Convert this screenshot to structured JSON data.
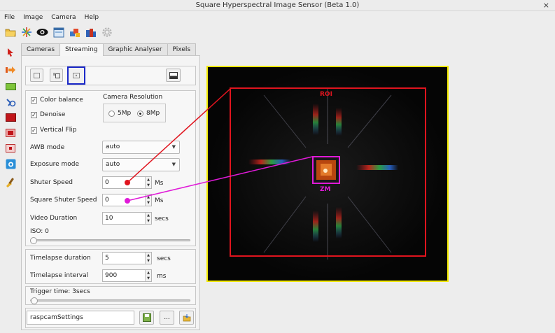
{
  "window": {
    "title": "Square Hyperspectral Image Sensor (Beta 1.0)",
    "close_glyph": "×"
  },
  "menu": [
    "File",
    "Image",
    "Camera",
    "Help"
  ],
  "toolbar": [
    "open-folder-icon",
    "burst-icon",
    "eye-icon",
    "window-icon",
    "cubes-icon",
    "cubes-color-icon",
    "gear-icon"
  ],
  "sidebar": [
    "pointer-icon",
    "arrow-right-icon",
    "green-rect-icon",
    "tools-icon",
    "red-rect-icon",
    "red-rect-2-icon",
    "red-rect-3-icon",
    "camera-icon",
    "brush-icon"
  ],
  "tabs": [
    "Cameras",
    "Streaming",
    "Graphic Analyser",
    "Pixels"
  ],
  "active_tab": "Streaming",
  "settings": {
    "color_balance": "Color balance",
    "denoise": "Denoise",
    "vertical_flip": "Vertical Flip",
    "check_glyph": "✓",
    "camera_resolution": "Camera Resolution",
    "res_5": "5Mp",
    "res_8": "8Mp",
    "selected_resolution": "8Mp",
    "awb_label": "AWB mode",
    "awb_value": "auto",
    "exposure_label": "Exposure mode",
    "exposure_value": "auto",
    "shutter_label": "Shuter Speed",
    "shutter_value": "0",
    "shutter_unit": "Ms",
    "square_shutter_label": "Square Shuter Speed",
    "square_shutter_value": "0",
    "square_shutter_unit": "Ms",
    "video_label": "Video Duration",
    "video_value": "10",
    "video_unit": "secs",
    "iso_label": "ISO: 0"
  },
  "timelapse": {
    "duration_label": "Timelapse duration",
    "duration_value": "5",
    "duration_unit": "secs",
    "interval_label": "Timelapse interval",
    "interval_value": "900",
    "interval_unit": "ms"
  },
  "trigger": {
    "label": "Trigger time: 3secs"
  },
  "settings_file": {
    "value": "raspcamSettings",
    "browse_label": "..."
  },
  "viewer": {
    "roi_label": "ROI",
    "zm_label": "ZM",
    "roi_color": "#e0141e",
    "zm_color": "#e01ad8",
    "frame_color": "#f2e900"
  },
  "spin_glyphs": {
    "up": "▲",
    "down": "▼"
  },
  "combo_arrow": "▼"
}
